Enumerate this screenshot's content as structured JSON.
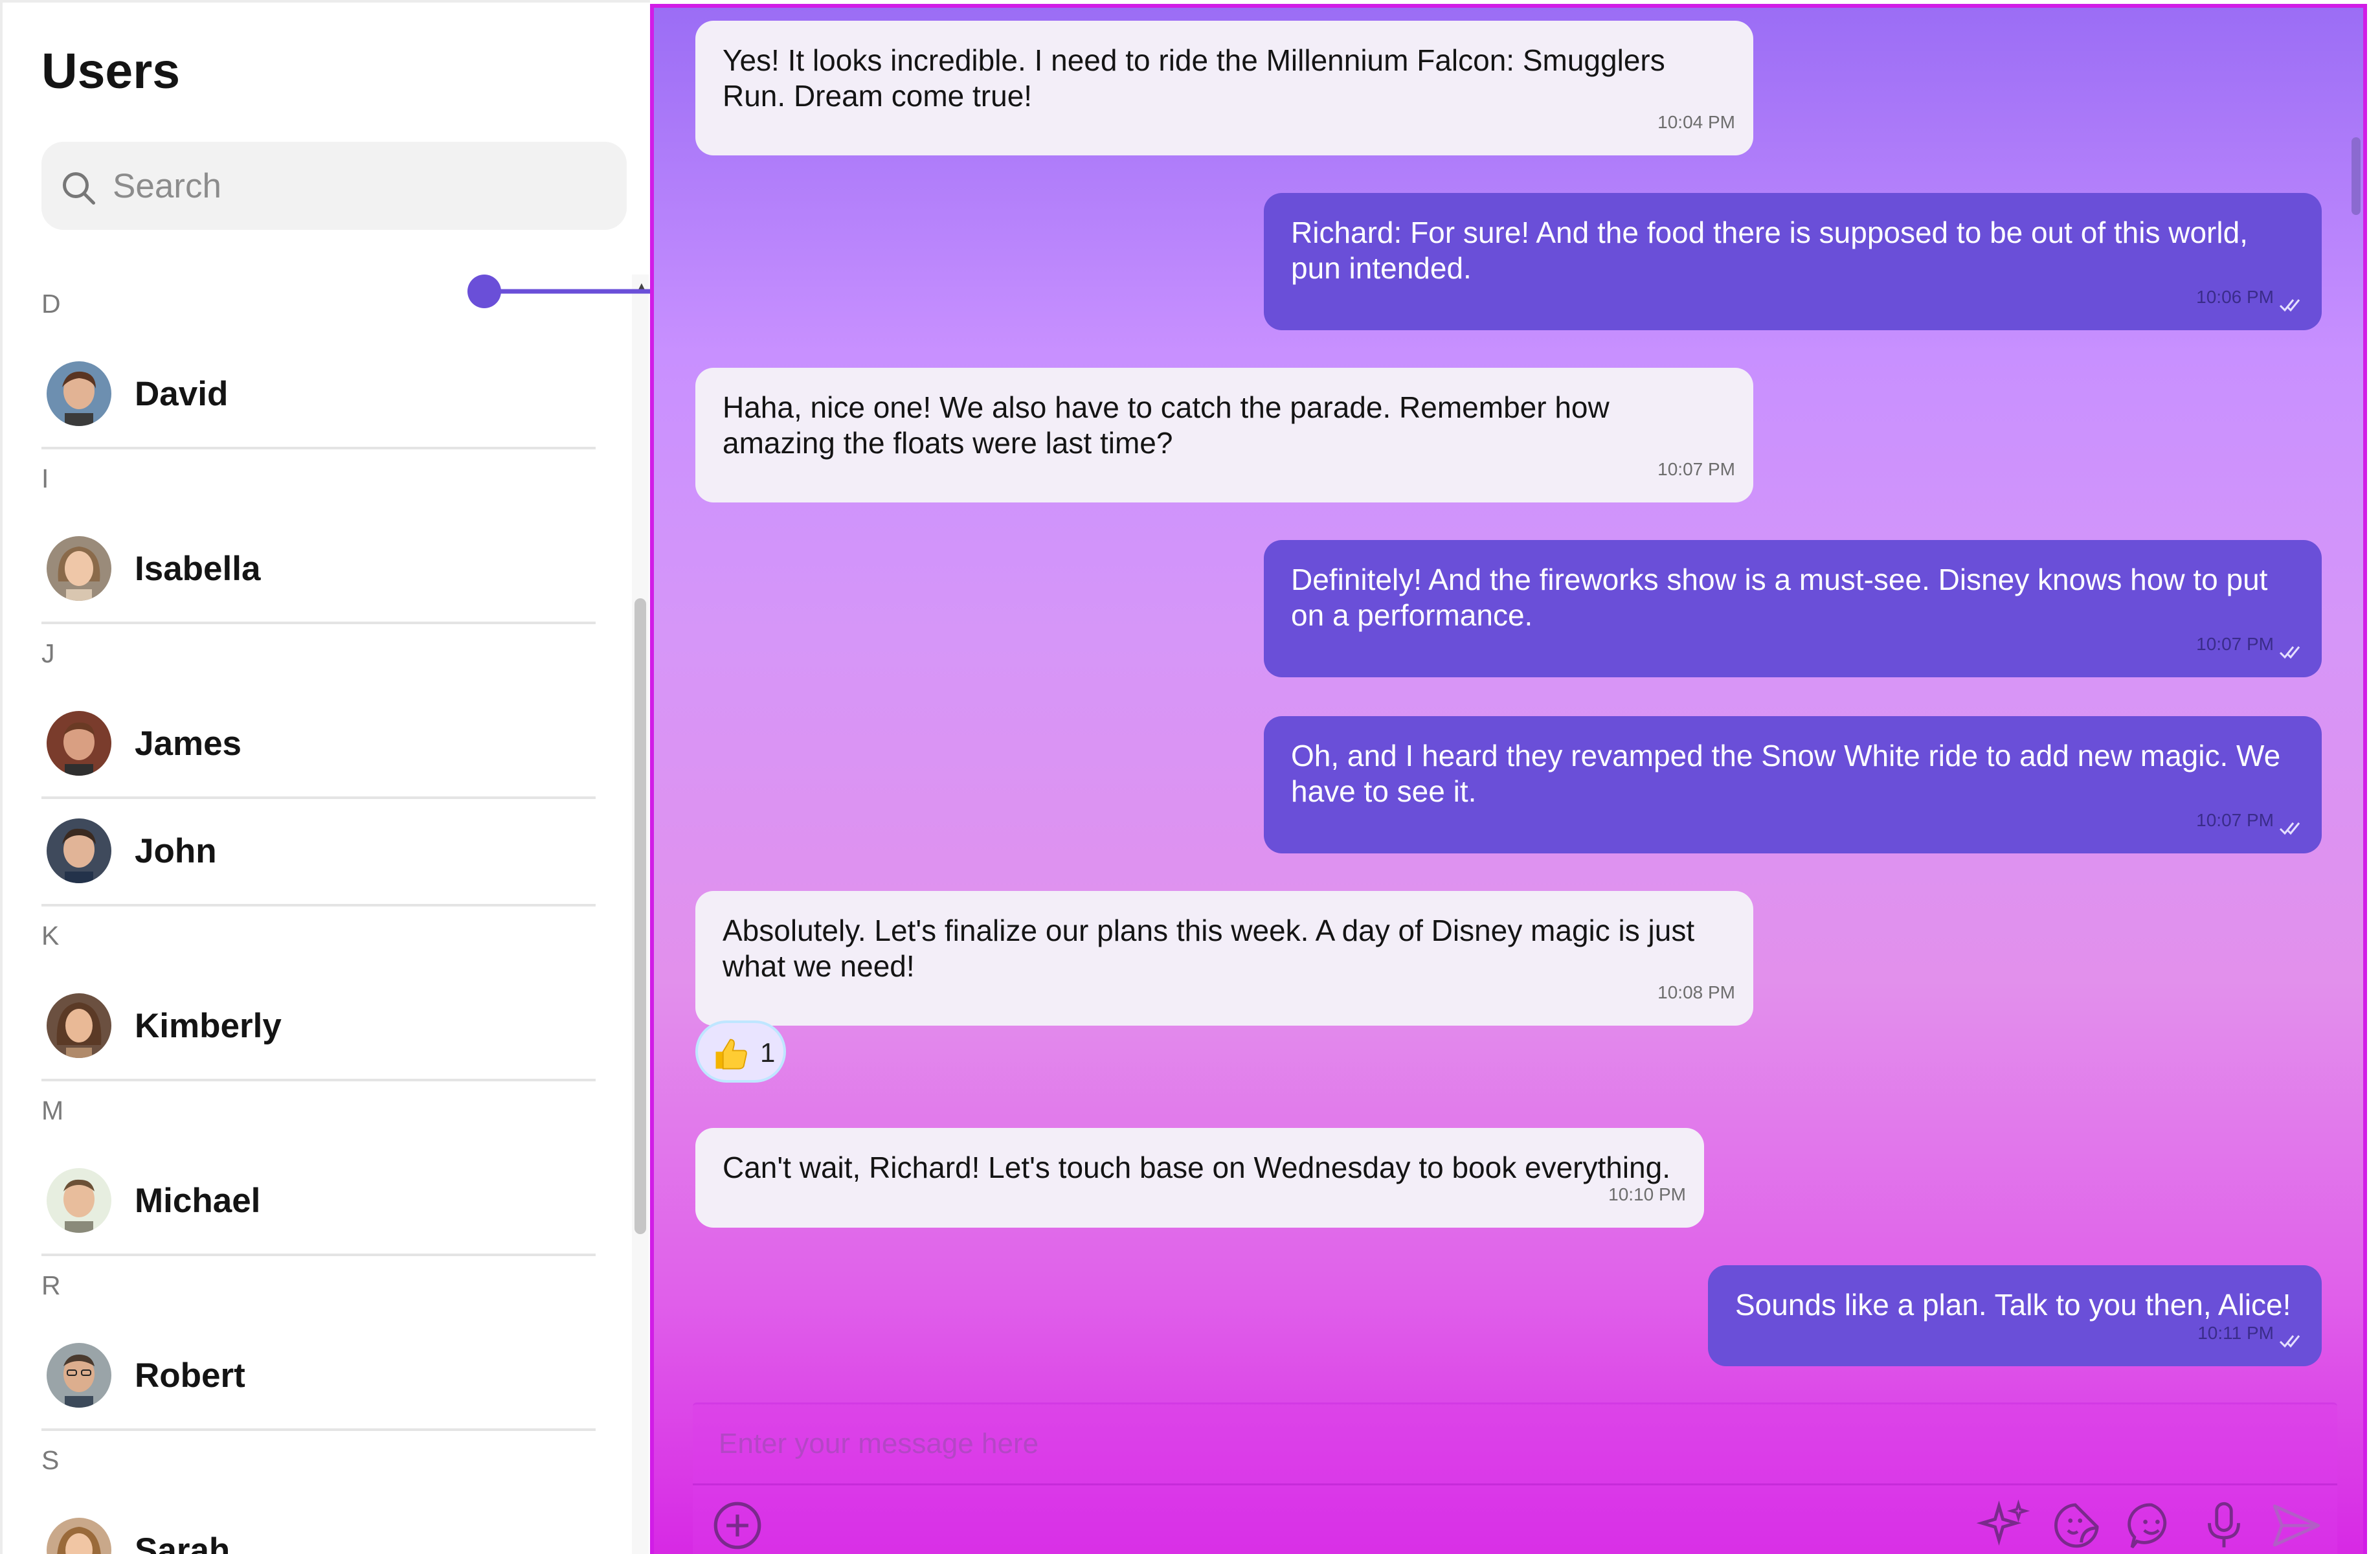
{
  "sidebar": {
    "title": "Users",
    "search_placeholder": "Search",
    "sections": [
      {
        "letter": "D",
        "users": [
          "David"
        ]
      },
      {
        "letter": "I",
        "users": [
          "Isabella"
        ]
      },
      {
        "letter": "J",
        "users": [
          "James",
          "John"
        ]
      },
      {
        "letter": "K",
        "users": [
          "Kimberly"
        ]
      },
      {
        "letter": "M",
        "users": [
          "Michael"
        ]
      },
      {
        "letter": "R",
        "users": [
          "Robert"
        ]
      },
      {
        "letter": "S",
        "users": [
          "Sarah"
        ]
      }
    ]
  },
  "chat": {
    "messages": [
      {
        "dir": "in",
        "text": "Yes! It looks incredible. I need to ride the Millennium Falcon: Smugglers Run. Dream come true!",
        "time": "10:04 PM"
      },
      {
        "dir": "out",
        "text": "Richard: For sure! And the food there is supposed to be out of this world, pun intended.",
        "time": "10:06 PM",
        "read": true
      },
      {
        "dir": "in",
        "text": "Haha, nice one! We also have to catch the parade. Remember how amazing the floats were last time?",
        "time": "10:07 PM"
      },
      {
        "dir": "out",
        "text": "Definitely! And the fireworks show is a must-see. Disney knows how to put on a performance.",
        "time": "10:07 PM",
        "read": true
      },
      {
        "dir": "out",
        "text": "Oh, and I heard they revamped the Snow White ride to add new magic. We have to see it.",
        "time": "10:07 PM",
        "read": true
      },
      {
        "dir": "in",
        "text": "Absolutely. Let's finalize our plans this week. A day of Disney magic is just what we need!",
        "time": "10:08 PM",
        "reaction": {
          "emoji": "thumbs-up",
          "count": "1"
        }
      },
      {
        "dir": "in",
        "text": "Can't wait, Richard! Let's touch base on Wednesday to book everything.",
        "time": "10:10 PM"
      },
      {
        "dir": "out",
        "text": "Sounds like a plan. Talk to you then, Alice!",
        "time": "10:11 PM",
        "read": true
      }
    ],
    "composer": {
      "placeholder": "Enter your message here",
      "icons": [
        "add-icon",
        "ai-sparkle-icon",
        "sticker-icon",
        "emoji-icon",
        "microphone-icon",
        "send-icon"
      ]
    }
  },
  "colors": {
    "accent": "#6a4fd8",
    "incoming_bubble": "#f3eef8",
    "border": "#d11de6"
  }
}
